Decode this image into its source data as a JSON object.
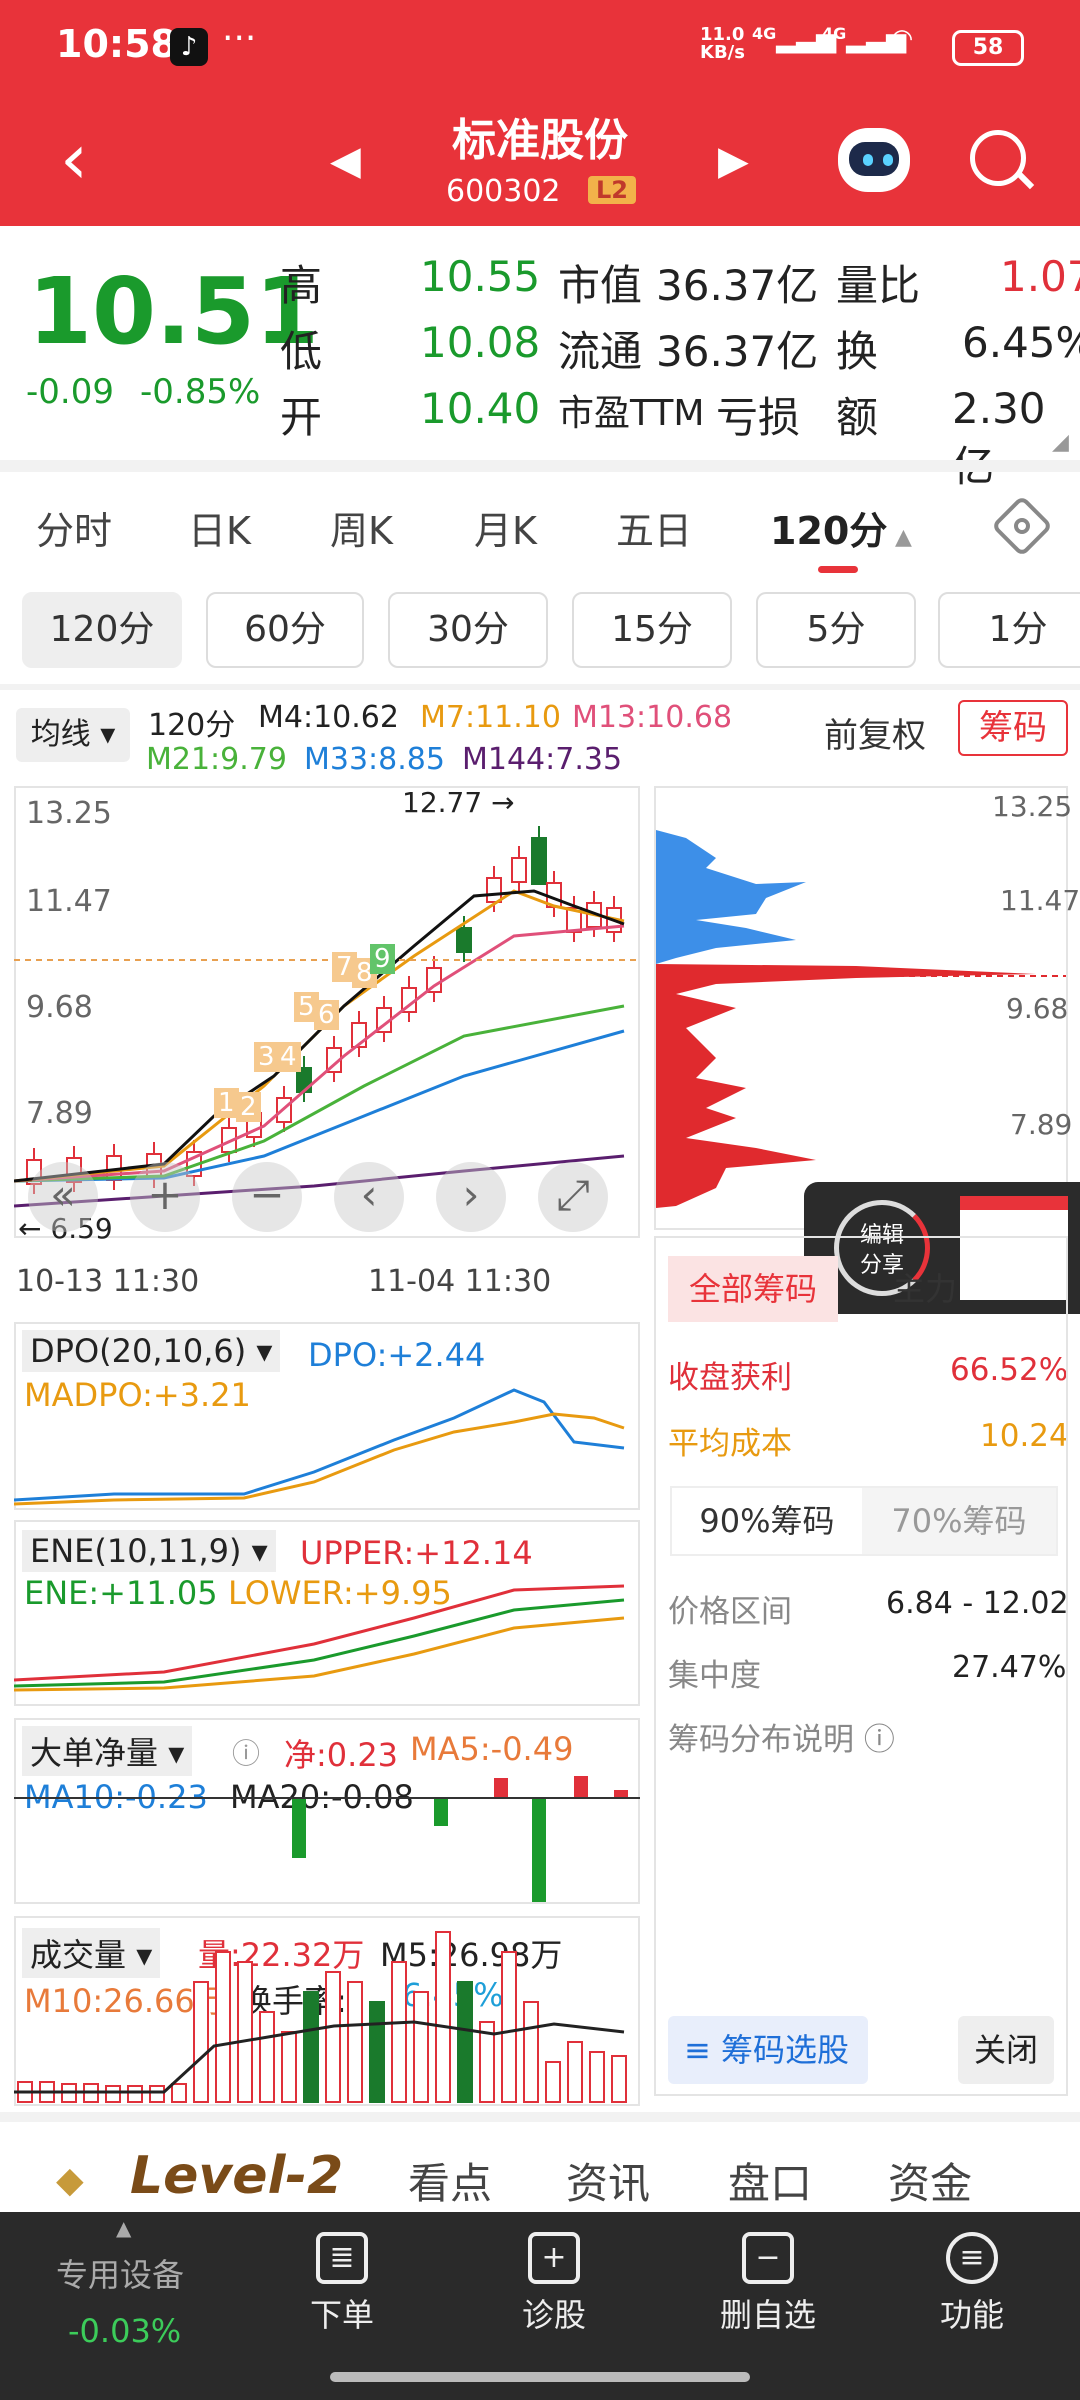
{
  "status_bar": {
    "time": "10:58",
    "app_badge": "♪",
    "more": "···",
    "net_speed_top": "11.0",
    "net_speed_bottom": "KB/s",
    "sig1": "4G",
    "sig2": "4G",
    "battery": "58"
  },
  "header": {
    "name": "标准股份",
    "code": "600302",
    "level_badge": "L2"
  },
  "quote": {
    "price": "10.51",
    "change": "-0.09",
    "change_pct": "-0.85%",
    "high_label": "高",
    "high": "10.55",
    "low_label": "低",
    "low": "10.08",
    "open_label": "开",
    "open": "10.40",
    "mktcap_label": "市值",
    "mktcap": "36.37亿",
    "float_label": "流通",
    "float": "36.37亿",
    "pe_label": "市盈TTM",
    "pe": "亏损",
    "vol_ratio_label": "量比",
    "vol_ratio": "1.07",
    "turnover_label": "换",
    "turnover": "6.45%",
    "amount_label": "额",
    "amount": "2.30亿"
  },
  "period_tabs": [
    "分时",
    "日K",
    "周K",
    "月K",
    "五日",
    "120分"
  ],
  "sub_periods": [
    "120分",
    "60分",
    "30分",
    "15分",
    "5分",
    "1分"
  ],
  "ma_bar": {
    "selector": "均线",
    "period": "120分",
    "m4": "M4:10.62",
    "m7": "M7:11.10",
    "m13": "M13:10.68",
    "m21": "M21:9.79",
    "m33": "M33:8.85",
    "m144": "M144:7.35",
    "fq": "前复权",
    "chip_btn": "筹码"
  },
  "kchart": {
    "y_labels": [
      "13.25",
      "11.47",
      "9.68",
      "7.89"
    ],
    "high_mark": "12.77",
    "low_mark": "6.59",
    "dates": [
      "10-13 11:30",
      "11-04 11:30"
    ],
    "seq": [
      "1",
      "2",
      "3",
      "4",
      "5",
      "6",
      "7",
      "8",
      "9"
    ]
  },
  "chip_panel": {
    "y_labels": [
      "13.25",
      "11.47",
      "9.68",
      "7.89"
    ],
    "share_label_1": "编辑",
    "share_label_2": "分享",
    "tab_all": "全部筹码",
    "tab_main": "主力",
    "profit_label": "收盘获利",
    "profit": "66.52%",
    "avg_cost_label": "平均成本",
    "avg_cost": "10.24",
    "pct90": "90%筹码",
    "pct70": "70%筹码",
    "range_label": "价格区间",
    "range": "6.84 - 12.02",
    "conc_label": "集中度",
    "conc": "27.47%",
    "explain": "筹码分布说明",
    "select_btn": "筹码选股",
    "close_btn": "关闭"
  },
  "dpo": {
    "name": "DPO(20,10,6)",
    "dpo": "DPO:+2.44",
    "madpo": "MADPO:+3.21"
  },
  "ene": {
    "name": "ENE(10,11,9)",
    "upper": "UPPER:+12.14",
    "ene": "ENE:+11.05",
    "lower": "LOWER:+9.95"
  },
  "bigorder": {
    "name": "大单净量",
    "net": "净:0.23",
    "ma5": "MA5:-0.49",
    "ma10": "MA10:-0.23",
    "ma20": "MA20:-0.08"
  },
  "volume": {
    "name": "成交量",
    "vol": "量:22.32万",
    "m5": "M5:26.98万",
    "m10": "M10:26.66万",
    "turnover_label": "换手率:",
    "turnover": "6.45%"
  },
  "bottom_tabs": {
    "level2": "Level-2",
    "tabs": [
      "看点",
      "资讯",
      "盘口",
      "资金"
    ]
  },
  "bottom_bar": {
    "index_name": "专用设备",
    "index_change": "-0.03%",
    "items": [
      "下单",
      "诊股",
      "删自选",
      "功能"
    ]
  },
  "colors": {
    "red": "#e8333a",
    "green": "#1a9a2c",
    "orange": "#e89a10",
    "blue": "#1e7fd8",
    "purple": "#5a1e6e"
  }
}
